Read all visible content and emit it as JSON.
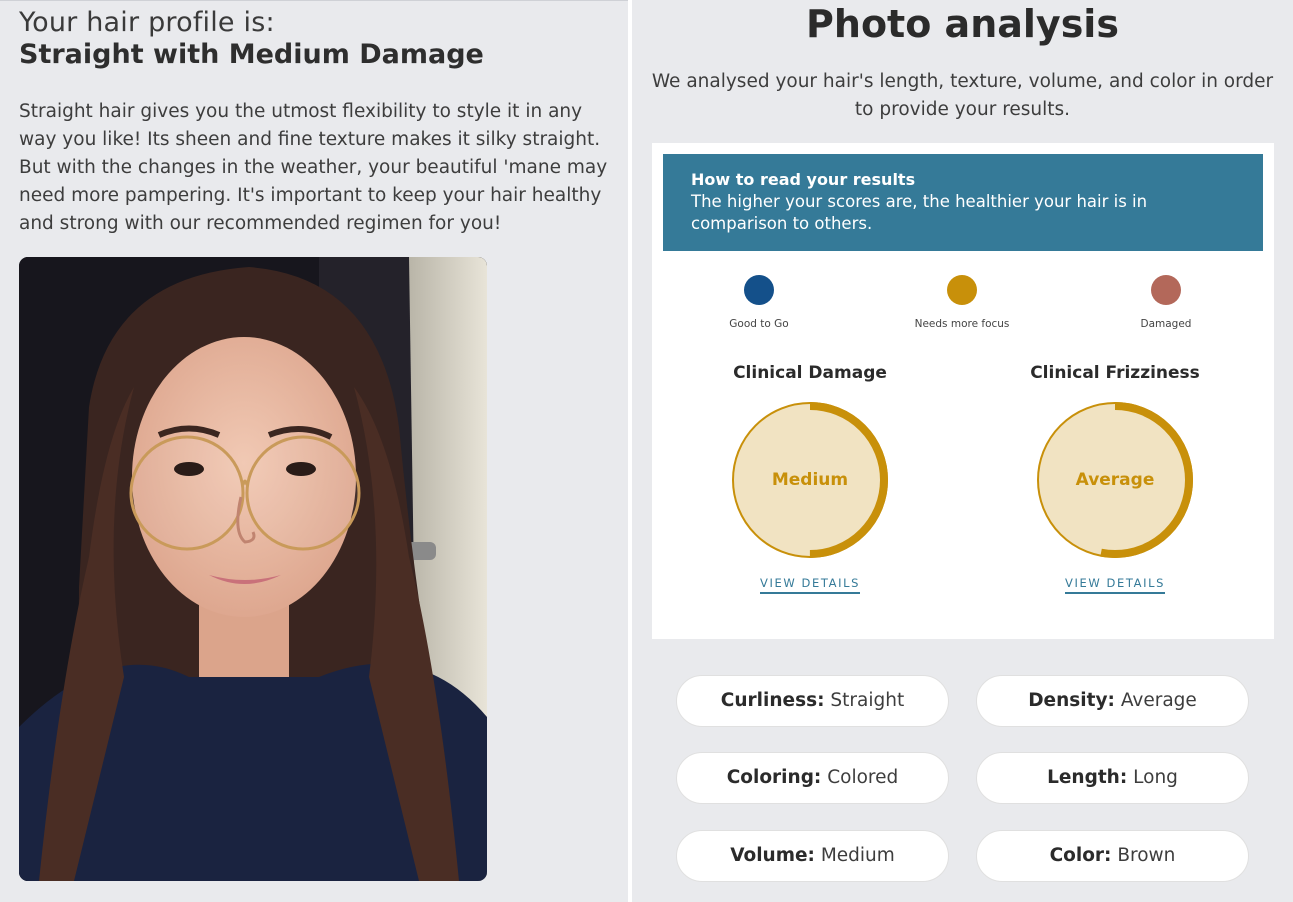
{
  "profile": {
    "intro": "Your hair profile is:",
    "type": "Straight with Medium Damage",
    "description": "Straight hair gives you the utmost flexibility to style it in any way you like! Its sheen and fine texture makes it silky straight. But with the changes in the weather, your beautiful 'mane may need more pampering. It's important to keep your hair healthy and strong with our recommended regimen for you!"
  },
  "analysis": {
    "title": "Photo analysis",
    "subtitle": "We analysed your hair's length, texture, volume, and color in order to provide your results.",
    "info": {
      "heading": "How to read your results",
      "text": "The higher your scores are, the healthier your hair is in comparison to others."
    },
    "legend": [
      {
        "label": "Good to Go",
        "color": "#14508a"
      },
      {
        "label": "Needs more focus",
        "color": "#c8900a"
      },
      {
        "label": "Damaged",
        "color": "#b3685a"
      }
    ],
    "metrics": [
      {
        "title": "Clinical Damage",
        "value": "Medium",
        "fill": 0.5,
        "link": "VIEW DETAILS"
      },
      {
        "title": "Clinical Frizziness",
        "value": "Average",
        "fill": 0.53,
        "link": "VIEW DETAILS"
      }
    ],
    "attributes": [
      {
        "key": "Curliness:",
        "value": "Straight"
      },
      {
        "key": "Density:",
        "value": "Average"
      },
      {
        "key": "Coloring:",
        "value": "Colored"
      },
      {
        "key": "Length:",
        "value": "Long"
      },
      {
        "key": "Volume:",
        "value": "Medium"
      },
      {
        "key": "Color:",
        "value": "Brown"
      }
    ]
  },
  "colors": {
    "accent": "#357a98",
    "gauge": "#c8900a",
    "gauge_bg": "#f1e3c2"
  }
}
